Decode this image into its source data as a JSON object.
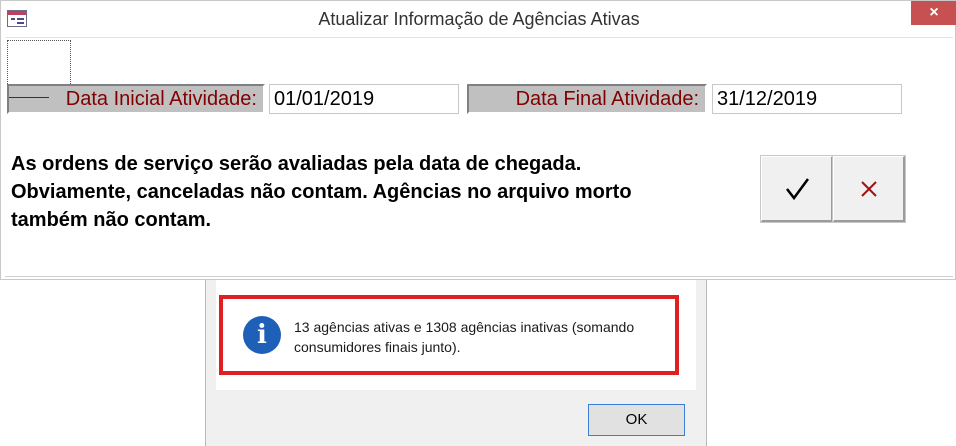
{
  "window": {
    "title": "Atualizar Informação de Agências Ativas",
    "close_glyph": "×"
  },
  "form": {
    "start_label": "Data Inicial Atividade:",
    "start_value": "01/01/2019",
    "end_label": "Data Final Atividade:",
    "end_value": "31/12/2019",
    "note": "As ordens de serviço serão avaliadas pela data de chegada. Obviamente, canceladas não contam. Agências no arquivo morto também não contam.",
    "confirm_icon": "checkmark-icon",
    "cancel_icon": "cross-icon"
  },
  "message": {
    "icon": "info-icon",
    "icon_glyph": "i",
    "text": "13 agências ativas e 1308 agências inativas (somando consumidores finais junto).",
    "ok_label": "OK"
  },
  "colors": {
    "label_text": "#800000",
    "highlight": "#e02020",
    "info_icon": "#1e5fb8",
    "cancel_x": "#a01010"
  }
}
